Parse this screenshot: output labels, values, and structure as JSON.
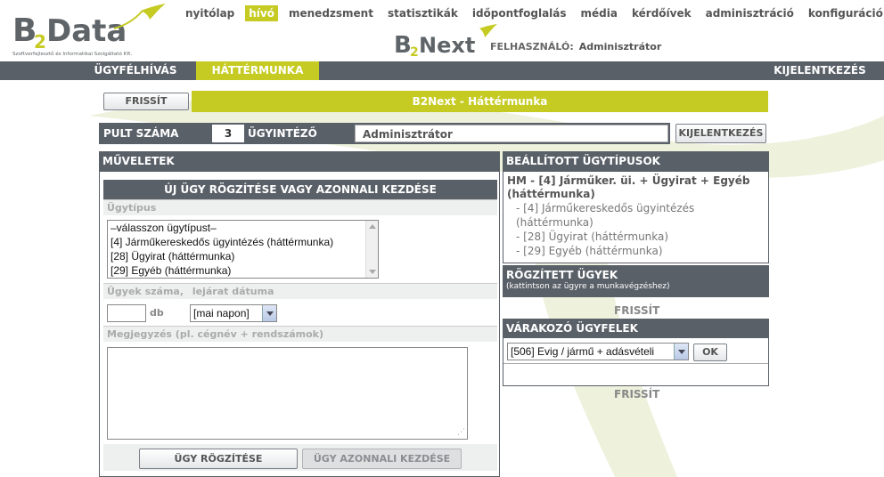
{
  "brand": {
    "logo_main": "B2Data",
    "logo_tagline": "Szoftverfejlesztő és Informatikai Szolgáltató Kft.",
    "logo_secondary": "B2Next",
    "accent_color": "#c5cb22",
    "bar_color": "#5a6068"
  },
  "topnav": [
    {
      "label": "nyitólap",
      "active": false
    },
    {
      "label": "hívó",
      "active": true
    },
    {
      "label": "menedzsment",
      "active": false
    },
    {
      "label": "statisztikák",
      "active": false
    },
    {
      "label": "időpontfoglalás",
      "active": false
    },
    {
      "label": "média",
      "active": false
    },
    {
      "label": "kérdőívek",
      "active": false
    },
    {
      "label": "adminisztráció",
      "active": false
    },
    {
      "label": "konfiguráció",
      "active": false
    }
  ],
  "user": {
    "label": "FELHASZNÁLÓ:",
    "name": "Adminisztrátor"
  },
  "subnav": {
    "items": [
      {
        "label": "ÜGYFÉLHÍVÁS"
      },
      {
        "label": "HÁTTÉRMUNKA"
      }
    ],
    "logout": "KIJELENTKEZÉS"
  },
  "toolbar": {
    "refresh": "FRISSÍT",
    "title": "B2Next - Háttérmunka"
  },
  "pult": {
    "label": "PULT SZÁMA",
    "number": "3",
    "agent_label": "ÜGYINTÉZŐ",
    "agent_name": "Adminisztrátor",
    "logout_button": "KIJELENTKEZÉS"
  },
  "operations": {
    "header": "MŰVELETEK",
    "section_title": "ÚJ ÜGY RÖGZÍTÉSE VAGY AZONNALI KEZDÉSE",
    "type_label": "Ügytípus",
    "type_options": [
      "–válasszon ügytípust–",
      "[4] Járműkereskedős ügyintézés (háttérmunka)",
      "[28] Ügyirat (háttérmunka)",
      "[29] Egyéb (háttérmunka)"
    ],
    "count_label": "Ügyek száma,",
    "deadline_label": "lejárat dátuma",
    "count_value": "",
    "count_unit": "db",
    "deadline_value": "[mai napon]",
    "note_label": "Megjegyzés (pl. cégnév + rendszámok)",
    "note_value": "",
    "record_button": "ÜGY RÖGZÍTÉSE",
    "start_button": "ÜGY AZONNALI KEZDÉSE"
  },
  "types_panel": {
    "header": "BEÁLLÍTOTT ÜGYTÍPUSOK",
    "main": "HM - [4] Járműker. üi. + Ügyirat + Egyéb (háttérmunka)",
    "items": [
      "- [4] Járműkereskedős ügyintézés (háttérmunka)",
      "- [28] Ügyirat (háttérmunka)",
      "- [29] Egyéb (háttérmunka)"
    ]
  },
  "recorded": {
    "header": "RÖGZÍTETT ÜGYEK",
    "subheader": "(kattintson az ügyre a munkavégzéshez)",
    "refresh": "FRISSÍT"
  },
  "waiting": {
    "header": "VÁRAKOZÓ ÜGYFELEK",
    "selected": "[506] Evig / jármű + adásvételi",
    "ok_button": "OK",
    "refresh": "FRISSÍT"
  }
}
